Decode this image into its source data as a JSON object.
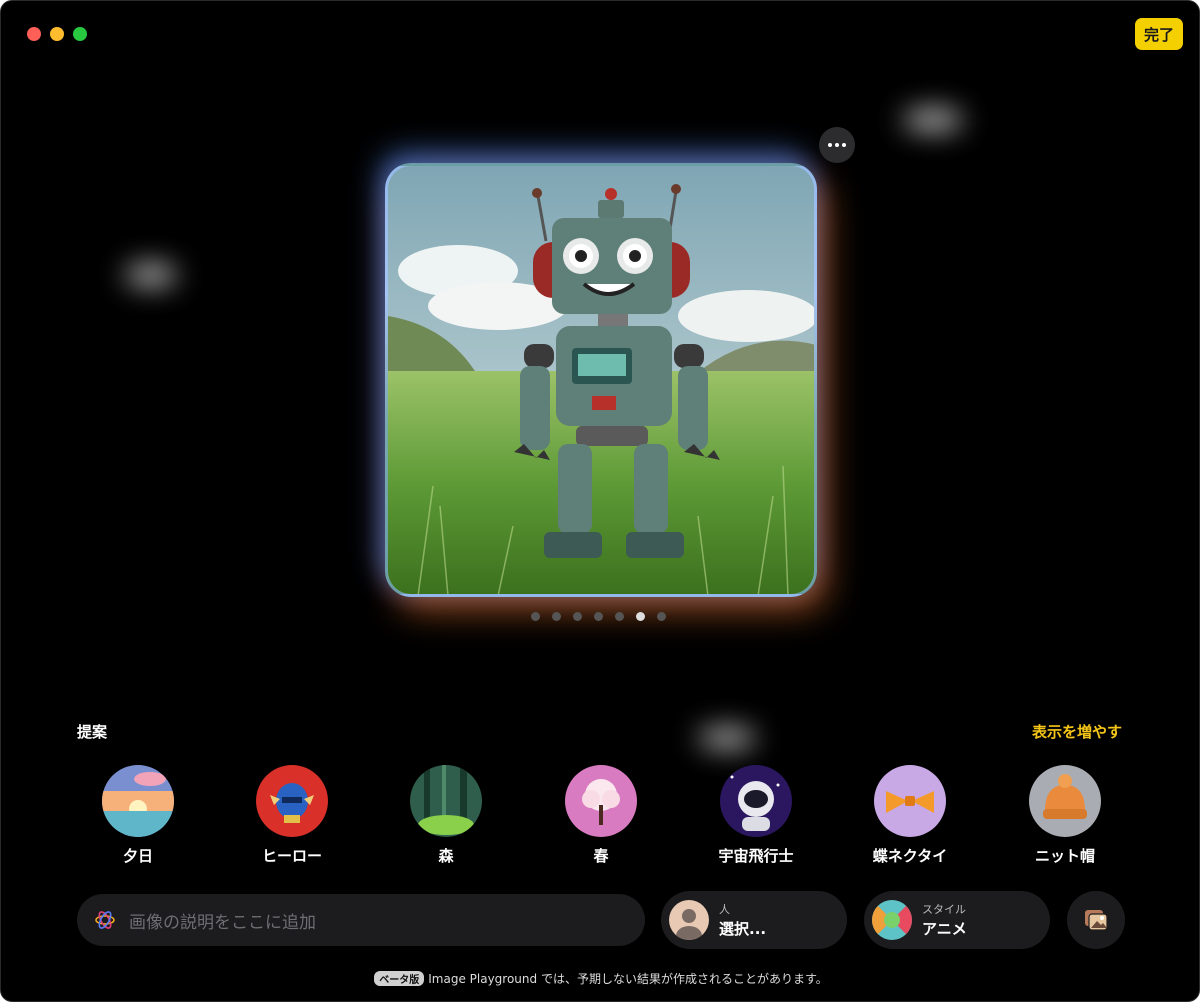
{
  "window": {
    "done_label": "完了"
  },
  "image": {
    "more_label": "•••",
    "page_count": 7,
    "active_page": 6
  },
  "suggestions": {
    "title": "提案",
    "show_more": "表示を増やす",
    "items": [
      {
        "label": "夕日",
        "icon": "sunset-icon"
      },
      {
        "label": "ヒーロー",
        "icon": "hero-mask-icon"
      },
      {
        "label": "森",
        "icon": "forest-icon"
      },
      {
        "label": "春",
        "icon": "cherry-tree-icon"
      },
      {
        "label": "宇宙飛行士",
        "icon": "astronaut-icon"
      },
      {
        "label": "蝶ネクタイ",
        "icon": "bowtie-icon"
      },
      {
        "label": "ニット帽",
        "icon": "knit-hat-icon"
      }
    ]
  },
  "prompt": {
    "placeholder": "画像の説明をここに追加",
    "icon": "playground-icon"
  },
  "person_chip": {
    "small": "人",
    "big": "選択..."
  },
  "style_chip": {
    "small": "スタイル",
    "big": "アニメ"
  },
  "gallery": {
    "icon": "gallery-icon"
  },
  "footer": {
    "beta": "ベータ版",
    "text": "Image Playground では、予期しない結果が作成されることがあります。"
  },
  "colors": {
    "accent": "#f5c518",
    "done_bg": "#f5d000",
    "background": "#000000",
    "chip_bg": "#1c1c1e"
  }
}
